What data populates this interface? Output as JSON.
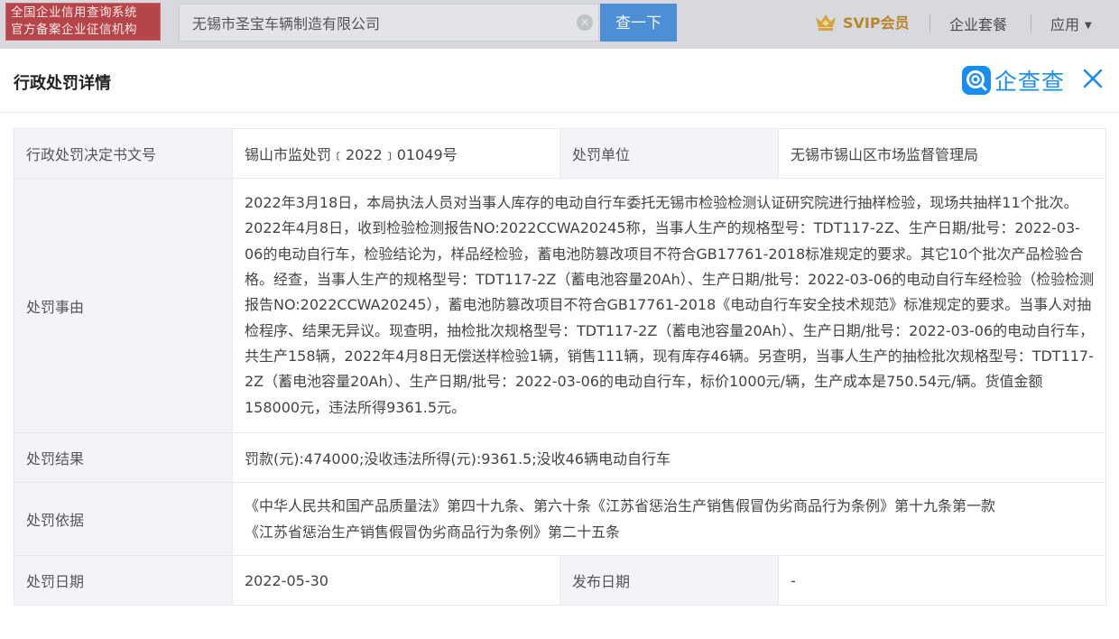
{
  "header": {
    "badge_line1": "全国企业信用查询系统",
    "badge_line2": "官方备案企业征信机构",
    "search_value": "无锡市圣宝车辆制造有限公司",
    "search_button": "查一下",
    "svip_label": "SVIP会员",
    "nav_package": "企业套餐",
    "nav_apps": "应用",
    "colors": {
      "bar": "#d7d9de",
      "badge": "#b6454a",
      "button": "#4d8fd4",
      "svip": "#b6862a"
    }
  },
  "modal": {
    "title": "行政处罚详情",
    "brand": "企查查",
    "brand_color": "#1a8df0"
  },
  "detail": {
    "doc_no_label": "行政处罚决定书文号",
    "doc_no_value": "锡山市监处罚﹝2022﹞01049号",
    "unit_label": "处罚单位",
    "unit_value": "无锡市锡山区市场监督管理局",
    "reason_label": "处罚事由",
    "reason_value": "2022年3月18日，本局执法人员对当事人库存的电动自行车委托无锡市检验检测认证研究院进行抽样检验，现场共抽样11个批次。2022年4月8日，收到检验检测报告NO:2022CCWA20245称，当事人生产的规格型号：TDT117-2Z、生产日期/批号：2022-03-06的电动自行车，检验结论为，样品经检验，蓄电池防篡改项目不符合GB17761-2018标准规定的要求。其它10个批次产品检验合格。经查，当事人生产的规格型号：TDT117-2Z（蓄电池容量20Ah）、生产日期/批号：2022-03-06的电动自行车经检验（检验检测报告NO:2022CCWA20245），蓄电池防篡改项目不符合GB17761-2018《电动自行车安全技术规范》标准规定的要求。当事人对抽检程序、结果无异议。现查明，抽检批次规格型号：TDT117-2Z（蓄电池容量20Ah）、生产日期/批号：2022-03-06的电动自行车，共生产158辆，2022年4月8日无偿送样检验1辆，销售111辆，现有库存46辆。另查明，当事人生产的抽检批次规格型号：TDT117-2Z（蓄电池容量20Ah）、生产日期/批号：2022-03-06的电动自行车，标价1000元/辆，生产成本是750.54元/辆。货值金额158000元，违法所得9361.5元。",
    "result_label": "处罚结果",
    "result_value": "罚款(元):474000;没收违法所得(元):9361.5;没收46辆电动自行车",
    "basis_label": "处罚依据",
    "basis_line1": "《中华人民共和国产品质量法》第四十九条、第六十条《江苏省惩治生产销售假冒伪劣商品行为条例》第十九条第一款",
    "basis_line2": "《江苏省惩治生产销售假冒伪劣商品行为条例》第二十五条",
    "date_label": "处罚日期",
    "date_value": "2022-05-30",
    "publish_label": "发布日期",
    "publish_value": "-"
  }
}
